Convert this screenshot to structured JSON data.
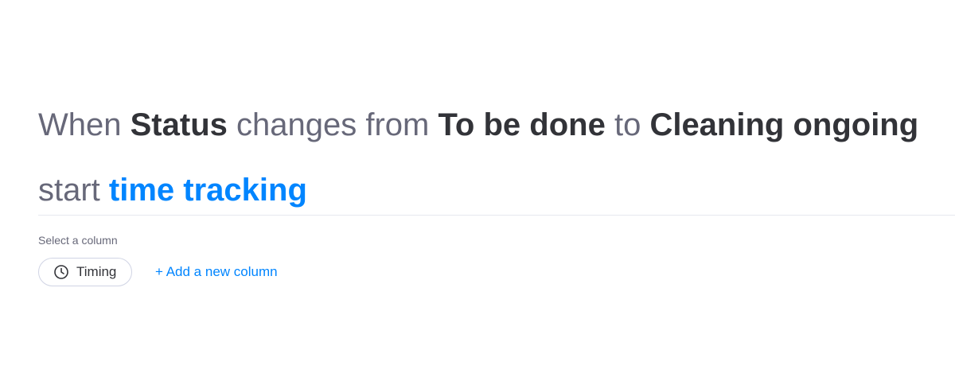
{
  "recipe": {
    "line1": {
      "when": "When",
      "column": "Status",
      "changes_from": "changes from",
      "from_value": "To be done",
      "to": "to",
      "to_value": "Cleaning ongoing"
    },
    "line2": {
      "start": "start",
      "action": "time tracking"
    }
  },
  "column_picker": {
    "label": "Select a column",
    "selected": {
      "icon": "clock-icon",
      "label": "Timing"
    },
    "add_new": "+ Add a new column"
  },
  "colors": {
    "accent": "#0085ff",
    "text_dark": "#323338",
    "text_light": "#676879",
    "divider": "#e6e9ef"
  }
}
